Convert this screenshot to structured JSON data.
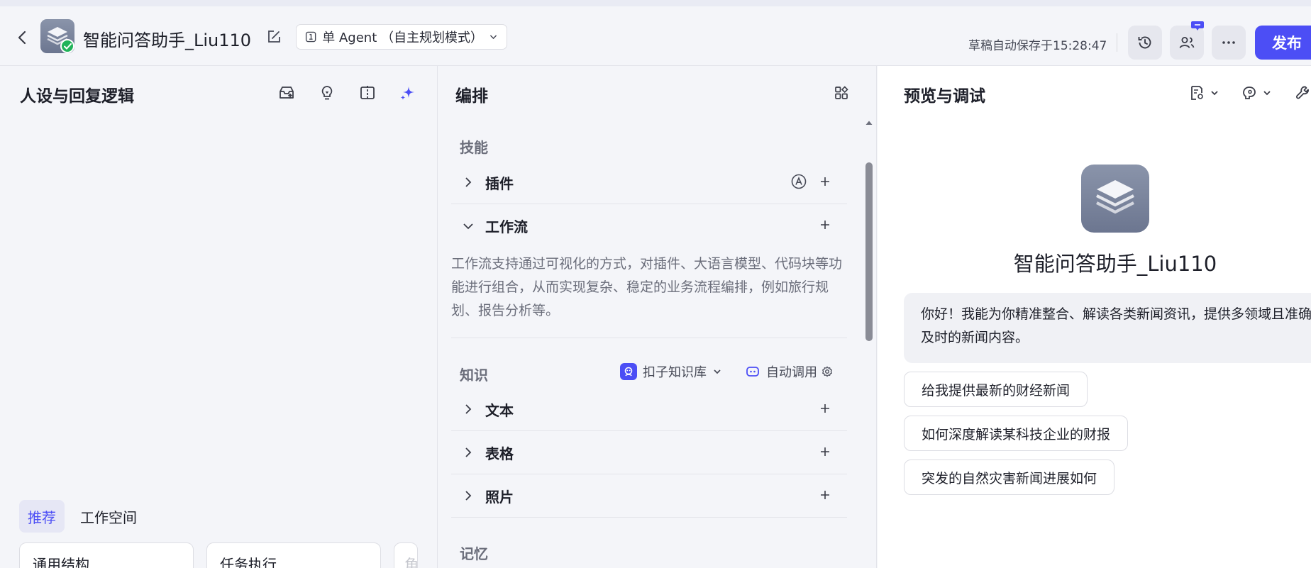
{
  "header": {
    "bot_name": "智能问答助手_Liu110",
    "mode_label": "单 Agent （自主规划模式）",
    "autosave_text": "草稿自动保存于15:28:47",
    "publish_label": "发布"
  },
  "left_panel": {
    "title": "人设与回复逻辑",
    "tabs": [
      {
        "label": "推荐",
        "active": true
      },
      {
        "label": "工作空间",
        "active": false
      }
    ],
    "templates": [
      "通用结构",
      "任务执行",
      "角"
    ]
  },
  "mid_panel": {
    "title": "编排",
    "skills_heading": "技能",
    "plugins_label": "插件",
    "workflow_label": "工作流",
    "workflow_desc": "工作流支持通过可视化的方式，对插件、大语言模型、代码块等功能进行组合，从而实现复杂、稳定的业务流程编排，例如旅行规划、报告分析等。",
    "knowledge_heading": "知识",
    "kb_select_label": "扣子知识库",
    "auto_call_label": "自动调用",
    "text_label": "文本",
    "table_label": "表格",
    "photo_label": "照片",
    "memory_heading": "记忆"
  },
  "right_panel": {
    "title": "预览与调试",
    "bot_name": "智能问答助手_Liu110",
    "greeting": "你好！我能为你精准整合、解读各类新闻资讯，提供多领域且准确及时的新闻内容。",
    "suggestions": [
      "给我提供最新的财经新闻",
      "如何深度解读某科技企业的财报",
      "突发的自然灾害新闻进展如何"
    ]
  },
  "colors": {
    "accent": "#4c4ef5",
    "badge_green": "#21b35a",
    "avatar_gray": "#7a839b"
  },
  "icons": [
    "back-icon",
    "bot-avatar-icon",
    "edit-icon",
    "agent-mode-icon",
    "history-icon",
    "collaborate-icon",
    "more-icon",
    "sparkle-icon"
  ]
}
